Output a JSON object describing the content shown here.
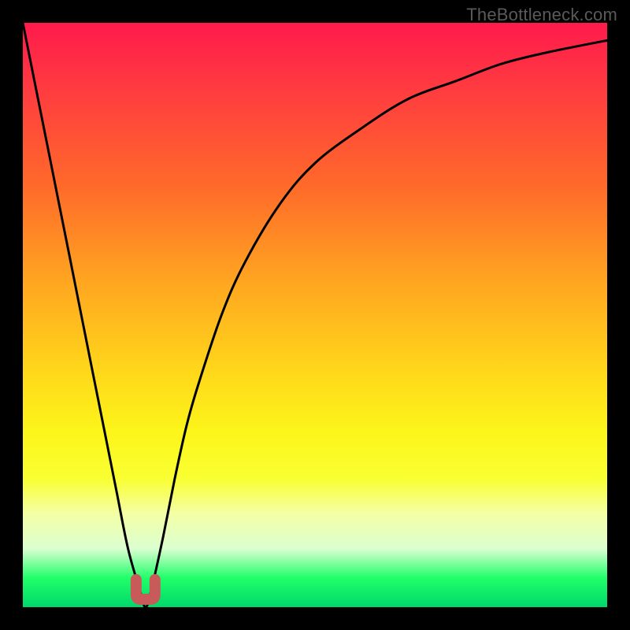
{
  "watermark": "TheBottleneck.com",
  "chart_data": {
    "type": "line",
    "title": "",
    "xlabel": "",
    "ylabel": "",
    "xlim": [
      0,
      100
    ],
    "ylim": [
      0,
      100
    ],
    "grid": false,
    "legend": false,
    "annotations": [],
    "colors": {
      "gradient_top": "#ff1a4c",
      "gradient_mid": "#fcf51a",
      "gradient_bottom": "#00d86a",
      "curve": "#000000",
      "dip_marker": "#c95a5a",
      "frame": "#000000"
    },
    "series": [
      {
        "name": "bottleneck-curve",
        "x": [
          0,
          2,
          4,
          6,
          8,
          10,
          12,
          14,
          16,
          18,
          20,
          21,
          22,
          24,
          26,
          28,
          30,
          34,
          38,
          44,
          50,
          58,
          66,
          74,
          82,
          90,
          100
        ],
        "y": [
          100,
          90,
          80,
          70,
          60,
          50,
          40,
          30,
          20,
          10,
          3,
          0,
          3,
          12,
          22,
          31,
          38,
          50,
          59,
          69,
          76,
          82,
          87,
          90,
          93,
          95,
          97
        ]
      }
    ],
    "minimum": {
      "x": 21,
      "y": 0
    }
  }
}
